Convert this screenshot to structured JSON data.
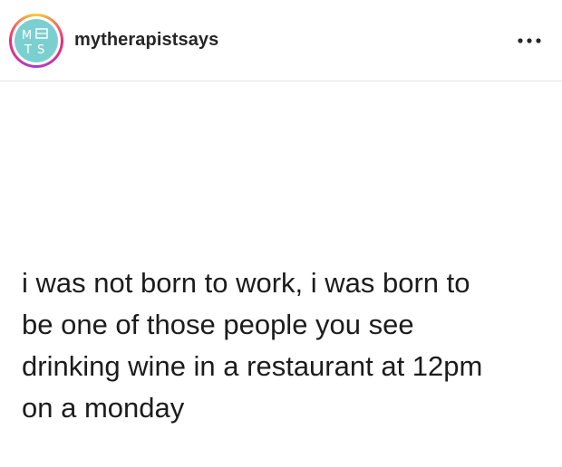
{
  "header": {
    "username": "mytherapistsays",
    "avatar_label": "M T S",
    "more_icon": "more-horizontal-icon"
  },
  "post": {
    "lines": [
      "i was not born to work, i was born to",
      "be one of those people you see",
      "drinking wine in a restaurant at 12pm",
      "on a monday"
    ]
  },
  "colors": {
    "avatar_bg": "#7ccfd1",
    "ring": "#ee2a7b",
    "text": "#1c1c1c"
  }
}
